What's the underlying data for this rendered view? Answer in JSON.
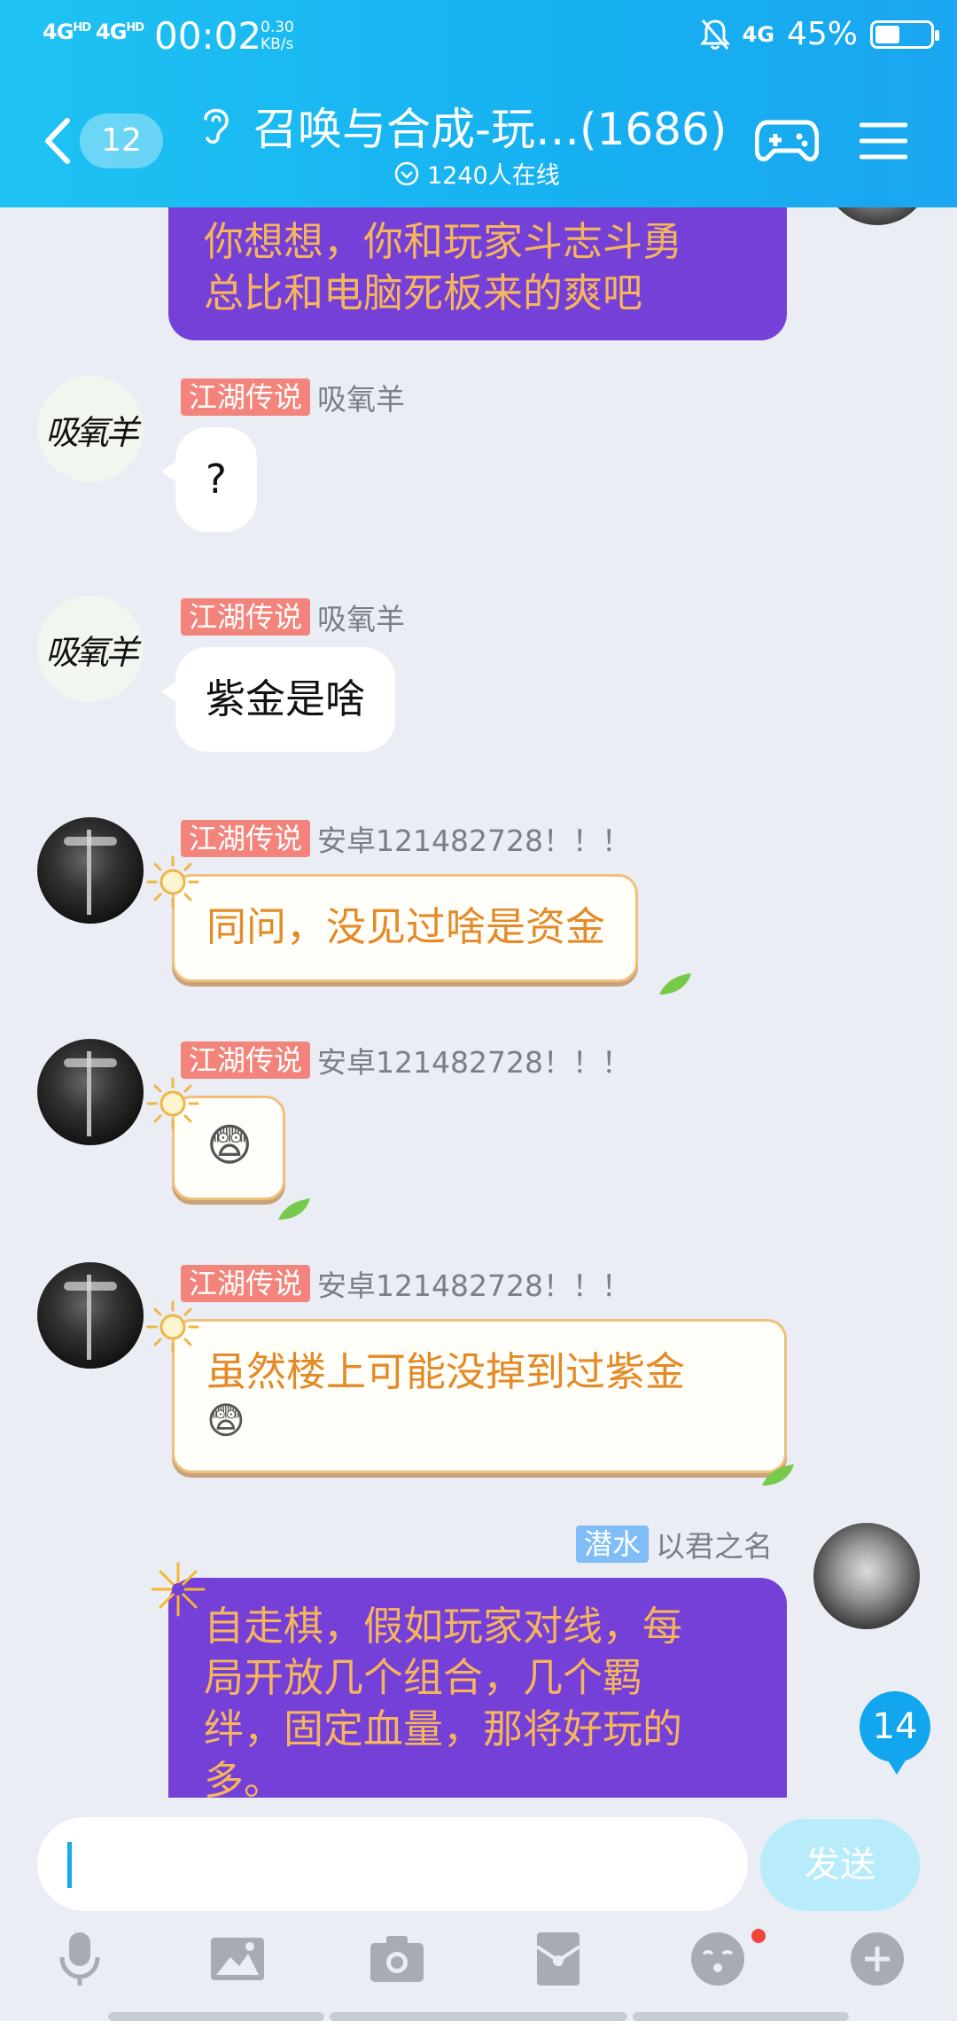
{
  "status_bar": {
    "signal1": "4G",
    "signal1_sup": "HD",
    "signal2": "4G",
    "signal2_sup": "HD",
    "time": "00:02",
    "speed_value": "0.30",
    "speed_unit": "KB/s",
    "network_right": "4G",
    "battery_percent": "45%",
    "battery_level": 0.45
  },
  "header": {
    "unread_count": "12",
    "title": "召唤与合成-玩…(1686)",
    "online_text": "1240人在线"
  },
  "messages": [
    {
      "type": "outgoing_partial_top",
      "lines": [
        "你想想，你和玩家斗志斗勇",
        "总比和电脑死板来的爽吧"
      ]
    },
    {
      "type": "incoming",
      "badge": "江湖传说",
      "sender": "吸氧羊",
      "avatar_text": "吸氧羊",
      "text": "?"
    },
    {
      "type": "incoming",
      "badge": "江湖传说",
      "sender": "吸氧羊",
      "avatar_text": "吸氧羊",
      "text": "紫金是啥"
    },
    {
      "type": "incoming_sun",
      "badge": "江湖传说",
      "sender": "安卓121482728！！！",
      "text": "同问，没见过啥是资金"
    },
    {
      "type": "incoming_sun_emoji",
      "badge": "江湖传说",
      "sender": "安卓121482728！！！",
      "emoji": "😨"
    },
    {
      "type": "incoming_sun",
      "badge": "江湖传说",
      "sender": "安卓121482728！！！",
      "text": "虽然楼上可能没掉到过紫金",
      "emoji": "😨"
    },
    {
      "type": "outgoing",
      "badge": "潜水",
      "sender": "以君之名",
      "lines": [
        "自走棋，假如玩家对线，每",
        "局开放几个组合，几个羁",
        "绊，固定血量，那将好玩的",
        "多。"
      ]
    }
  ],
  "new_messages_count": "14",
  "input": {
    "value": "",
    "send_label": "发送"
  },
  "toolbar": {
    "tools": [
      "microphone-icon",
      "image-icon",
      "camera-icon",
      "red-packet-icon",
      "emoji-icon",
      "plus-icon"
    ]
  },
  "colors": {
    "header": "#1ab8f2",
    "badge_red": "#f2847b",
    "badge_blue": "#7fbdf6",
    "purple_bubble": "#7440d8",
    "purple_text": "#f6b55b",
    "sun_text": "#e48a26"
  }
}
